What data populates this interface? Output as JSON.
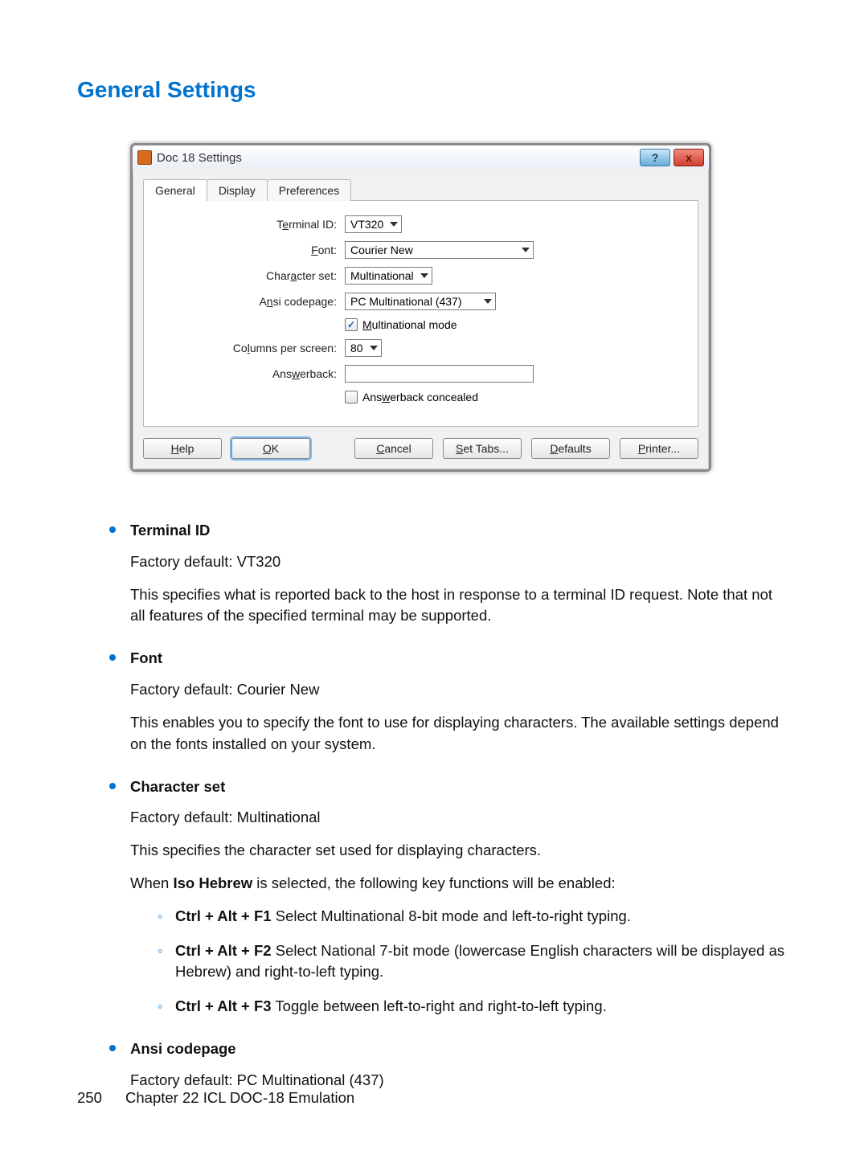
{
  "heading": "General Settings",
  "dialog": {
    "title": "Doc 18 Settings",
    "help_btn": "?",
    "close_btn": "x",
    "tabs": [
      "General",
      "Display",
      "Preferences"
    ],
    "active_tab": 0,
    "fields": {
      "terminal_id": {
        "label_pre": "T",
        "label_ul": "e",
        "label_post": "rminal ID:",
        "value": "VT320"
      },
      "font": {
        "label_pre": "",
        "label_ul": "F",
        "label_post": "ont:",
        "value": "Courier New"
      },
      "charset": {
        "label_pre": "Char",
        "label_ul": "a",
        "label_post": "cter set:",
        "value": "Multinational"
      },
      "ansi": {
        "label_pre": "A",
        "label_ul": "n",
        "label_post": "si codepage:",
        "value": "PC Multinational (437)"
      },
      "multimode": {
        "label_ul": "M",
        "label_post": "ultinational mode",
        "checked": true
      },
      "columns": {
        "label_pre": "Co",
        "label_ul": "l",
        "label_post": "umns per screen:",
        "value": "80"
      },
      "answerback": {
        "label_pre": "Ans",
        "label_ul": "w",
        "label_post": "erback:",
        "value": ""
      },
      "ab_conceal": {
        "label_pre": "Ans",
        "label_ul": "w",
        "label_post": "erback concealed",
        "checked": false
      }
    },
    "buttons": {
      "help": {
        "ul": "H",
        "rest": "elp"
      },
      "ok": {
        "ul": "O",
        "rest": "K"
      },
      "cancel": {
        "ul": "C",
        "rest": "ancel"
      },
      "settabs": {
        "ul": "S",
        "rest": "et Tabs..."
      },
      "defaults": {
        "ul": "D",
        "rest": "efaults"
      },
      "printer": {
        "ul": "P",
        "rest": "rinter..."
      }
    }
  },
  "doc": {
    "items": [
      {
        "title": "Terminal ID",
        "default": "Factory default: VT320",
        "body1": "This specifies what is reported back to the host in response to a terminal ID request. Note that not all features of the specified terminal may be supported."
      },
      {
        "title": "Font",
        "default": "Factory default: Courier New",
        "body1": "This enables you to specify the font to use for displaying characters. The available settings depend on the fonts installed on your system."
      },
      {
        "title": "Character set",
        "default": "Factory default: Multinational",
        "body1": "This specifies the character set used for displaying characters.",
        "body2_pre": "When ",
        "body2_bold": "Iso Hebrew",
        "body2_post": " is selected, the following key functions will be enabled:",
        "sub": [
          {
            "keys": "Ctrl + Alt + F1",
            "text": " Select Multinational 8-bit mode and left-to-right typing."
          },
          {
            "keys": "Ctrl + Alt + F2",
            "text": " Select National 7-bit mode (lowercase English characters will be displayed as Hebrew) and right-to-left typing."
          },
          {
            "keys": "Ctrl + Alt + F3",
            "text": " Toggle between left-to-right and right-to-left typing."
          }
        ]
      },
      {
        "title": "Ansi codepage",
        "default": "Factory default: PC Multinational (437)"
      }
    ]
  },
  "footer": {
    "page_number": "250",
    "chapter": "Chapter 22   ICL DOC-18 Emulation"
  }
}
